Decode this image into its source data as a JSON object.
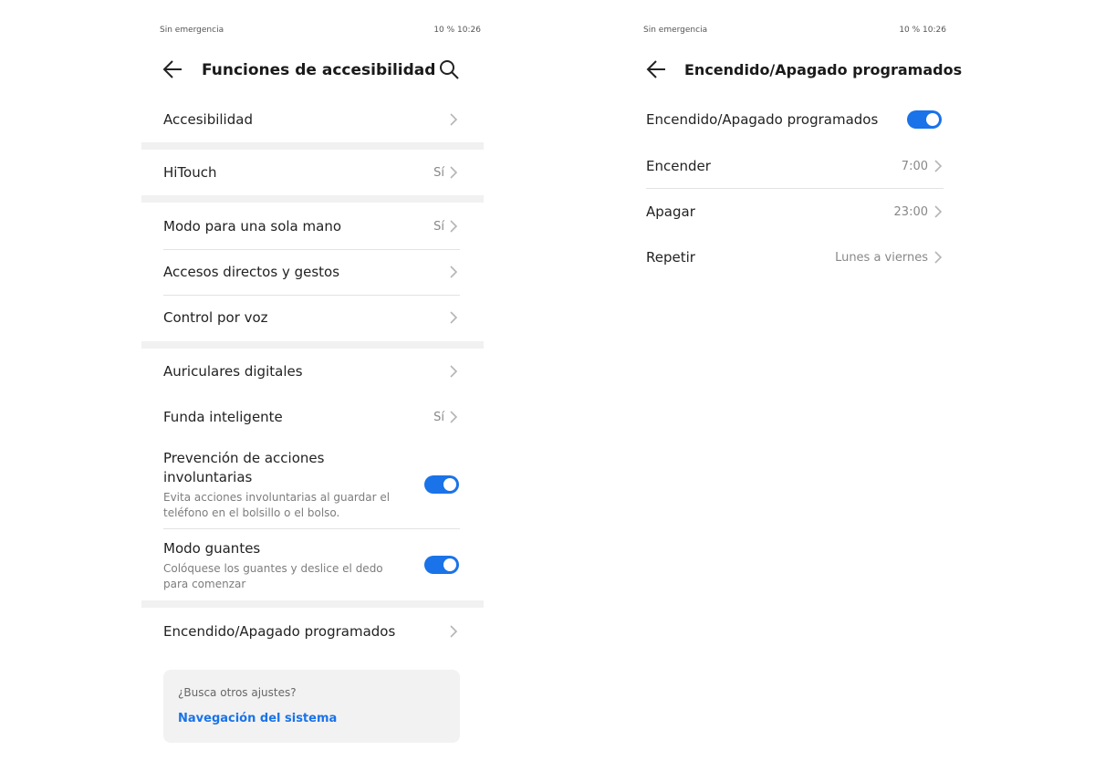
{
  "colors": {
    "accent": "#1a73e8",
    "separator": "#f1f1f1",
    "divider": "#e2e2e2"
  },
  "screen1": {
    "status": {
      "left": "Sin emergencia",
      "right": "10 % 10:26"
    },
    "header": {
      "title": "Funciones de accesibilidad",
      "back_icon": "arrow-left-icon",
      "search_icon": "search-icon"
    },
    "items": {
      "accesibilidad": {
        "label": "Accesibilidad"
      },
      "hitouch": {
        "label": "HiTouch",
        "value": "Sí"
      },
      "una_mano": {
        "label": "Modo para una sola mano",
        "value": "Sí"
      },
      "accesos": {
        "label": "Accesos directos y gestos"
      },
      "voz": {
        "label": "Control por voz"
      },
      "auriculares": {
        "label": "Auriculares digitales"
      },
      "funda": {
        "label": "Funda inteligente",
        "value": "Sí"
      },
      "prevencion": {
        "label_line1": "Prevención de acciones",
        "label_line2": "involuntarias",
        "desc_line1": "Evita acciones involuntarias al guardar el",
        "desc_line2": "teléfono en el bolsillo o el bolso.",
        "enabled": true
      },
      "guantes": {
        "label": "Modo guantes",
        "desc_line1": "Colóquese los guantes y deslice el dedo",
        "desc_line2": "para comenzar",
        "enabled": true
      },
      "encendido": {
        "label": "Encendido/Apagado programados"
      }
    },
    "card": {
      "question": "¿Busca otros ajustes?",
      "link": "Navegación del sistema"
    }
  },
  "screen2": {
    "status": {
      "left": "Sin emergencia",
      "right": "10 % 10:26"
    },
    "header": {
      "title": "Encendido/Apagado programados",
      "back_icon": "arrow-left-icon"
    },
    "items": {
      "master": {
        "label": "Encendido/Apagado programados",
        "enabled": true
      },
      "encender": {
        "label": "Encender",
        "value": "7:00"
      },
      "apagar": {
        "label": "Apagar",
        "value": "23:00"
      },
      "repetir": {
        "label": "Repetir",
        "value": "Lunes a viernes"
      }
    }
  }
}
